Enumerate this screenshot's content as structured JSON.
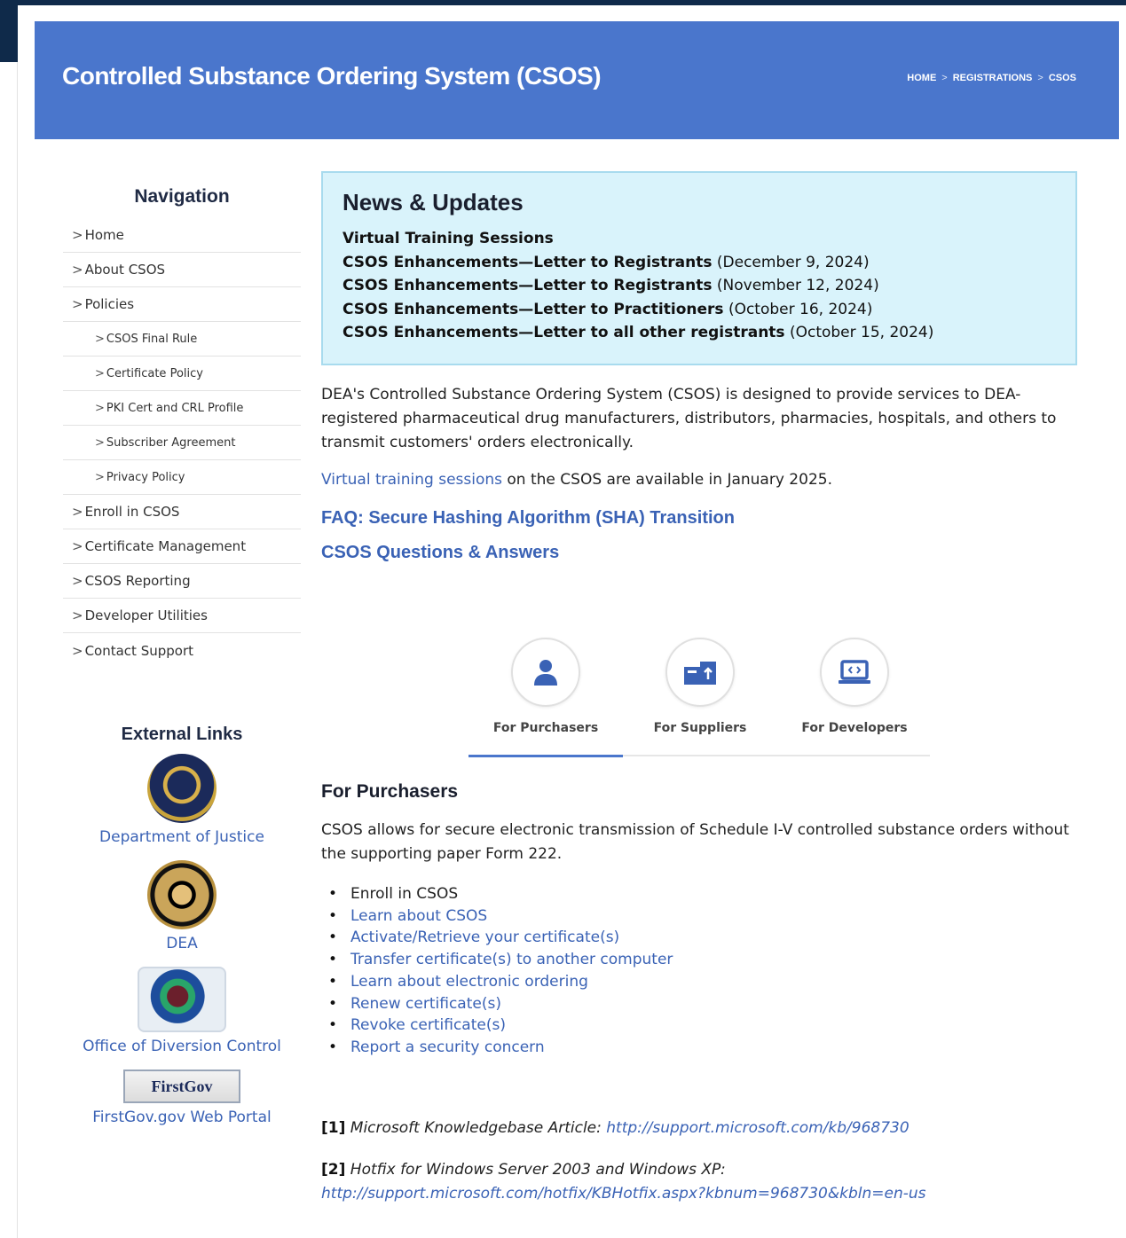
{
  "header": {
    "title": "Controlled Substance Ordering System (CSOS)",
    "breadcrumb": [
      "HOME",
      "REGISTRATIONS",
      "CSOS"
    ],
    "separator": ">"
  },
  "sidebar": {
    "heading": "Navigation",
    "chevron": ">",
    "items": [
      {
        "label": "Home"
      },
      {
        "label": "About CSOS"
      },
      {
        "label": "Policies"
      },
      {
        "label": "CSOS Final Rule"
      },
      {
        "label": "Certificate Policy"
      },
      {
        "label": "PKI Cert and CRL Profile"
      },
      {
        "label": "Subscriber Agreement"
      },
      {
        "label": "Privacy Policy"
      },
      {
        "label": "Enroll in CSOS"
      },
      {
        "label": "Certificate Management"
      },
      {
        "label": "CSOS Reporting"
      },
      {
        "label": "Developer Utilities"
      },
      {
        "label": "Contact Support"
      }
    ]
  },
  "external": {
    "heading": "External Links",
    "links": [
      {
        "label": "Department of Justice"
      },
      {
        "label": "DEA"
      },
      {
        "label": "Office of Diversion Control"
      },
      {
        "label": "FirstGov.gov Web Portal",
        "logo_text": "FirstGov"
      }
    ]
  },
  "news": {
    "title": "News & Updates",
    "items": [
      {
        "bold": "Virtual Training Sessions",
        "date": ""
      },
      {
        "bold": "CSOS Enhancements—Letter to Registrants",
        "date": "(December 9, 2024)"
      },
      {
        "bold": "CSOS Enhancements—Letter to Registrants",
        "date": "(November 12, 2024)"
      },
      {
        "bold": "CSOS Enhancements—Letter to Practitioners",
        "date": "(October 16, 2024)"
      },
      {
        "bold": "CSOS Enhancements—Letter to all other registrants",
        "date": "(October 15, 2024)"
      }
    ]
  },
  "main": {
    "intro": "DEA's Controlled Substance Ordering System (CSOS) is designed to provide services to DEA-registered pharmaceutical drug manufacturers, distributors, pharmacies, hospitals, and others to transmit customers' orders electronically.",
    "training_link": "Virtual training sessions",
    "training_rest": " on the CSOS are available in January 2025.",
    "faq_link": "FAQ: Secure Hashing Algorithm (SHA) Transition",
    "qa_link": "CSOS Questions & Answers"
  },
  "tabs": [
    {
      "label": "For Purchasers",
      "icon": "person-icon",
      "active": true
    },
    {
      "label": "For Suppliers",
      "icon": "boxes-icon",
      "active": false
    },
    {
      "label": "For Developers",
      "icon": "laptop-code-icon",
      "active": false
    }
  ],
  "purchasers": {
    "title": "For Purchasers",
    "text": "CSOS allows for secure electronic transmission of Schedule I-V controlled substance orders without the supporting paper Form 222.",
    "bullets": [
      {
        "label": "Enroll in CSOS",
        "link": false
      },
      {
        "label": "Learn about CSOS",
        "link": true
      },
      {
        "label": "Activate/Retrieve your certificate(s)",
        "link": true
      },
      {
        "label": "Transfer certificate(s) to another computer",
        "link": true
      },
      {
        "label": "Learn about electronic ordering",
        "link": true
      },
      {
        "label": "Renew certificate(s)",
        "link": true
      },
      {
        "label": "Revoke certificate(s)",
        "link": true
      },
      {
        "label": "Report a security concern",
        "link": true
      }
    ]
  },
  "references": [
    {
      "num": "[1]",
      "label": "Microsoft Knowledgebase Article:",
      "url": "http://support.microsoft.com/kb/968730"
    },
    {
      "num": "[2]",
      "label": "Hotfix for Windows Server 2003 and Windows XP:",
      "url": "http://support.microsoft.com/hotfix/KBHotfix.aspx?kbnum=968730&kbln=en-us"
    }
  ],
  "colors": {
    "banner": "#4a76cc",
    "link": "#3a62b5",
    "news_bg": "#d9f3fb",
    "dark_frame": "#0f2a4a"
  }
}
